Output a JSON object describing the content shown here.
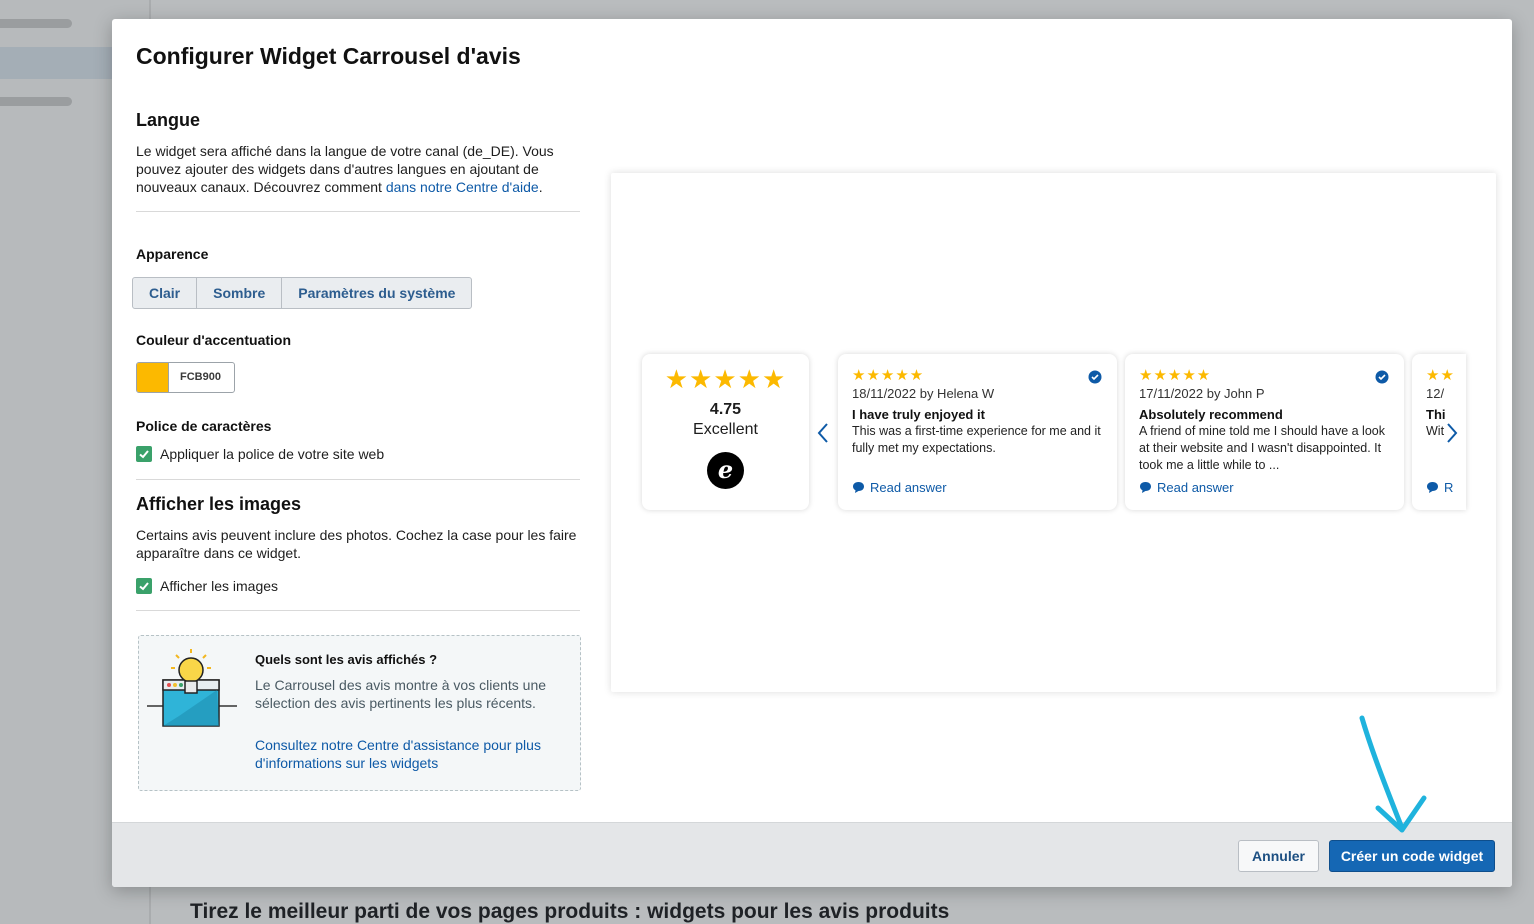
{
  "background": {
    "heading": "Tirez le meilleur parti de vos pages produits : widgets pour les avis produits"
  },
  "modal": {
    "title": "Configurer Widget Carrousel d'avis",
    "language": {
      "heading": "Langue",
      "text": "Le widget sera affiché dans la langue de votre canal (de_DE). Vous pouvez ajouter des widgets dans d'autres langues en ajoutant de nouveaux canaux. Découvrez comment",
      "link": "dans notre Centre d'aide",
      "after": "."
    },
    "appearance": {
      "label": "Apparence",
      "options": [
        "Clair",
        "Sombre",
        "Paramètres du système"
      ]
    },
    "accent": {
      "label": "Couleur d'accentuation",
      "value": "FCB900",
      "color": "#FCB900"
    },
    "font": {
      "label": "Police de caractères",
      "checkbox": "Appliquer la police de votre site web"
    },
    "images": {
      "heading": "Afficher les images",
      "text": "Certains avis peuvent inclure des photos. Cochez la case pour les faire apparaître dans ce widget.",
      "checkbox": "Afficher les images"
    },
    "info": {
      "title": "Quels sont les avis affichés ?",
      "text": "Le Carrousel des avis montre à vos clients une sélection des avis pertinents les plus récents.",
      "link": "Consultez notre Centre d'assistance pour plus d'informations sur les widgets"
    },
    "preview": {
      "summary": {
        "stars": "★★★★★",
        "rating": "4.75",
        "label": "Excellent",
        "logo": "e"
      },
      "reviews": [
        {
          "stars": "★★★★★",
          "date": "18/11/2022 by Helena W",
          "title": "I have truly enjoyed it",
          "body": "This was a first-time experience for me and it fully met my expectations.",
          "link": "Read answer"
        },
        {
          "stars": "★★★★★",
          "date": "17/11/2022 by John P",
          "title": "Absolutely recommend",
          "body": "A friend of mine told me I should have a look at their website and I wasn't disappointed. It took me a little while to ...",
          "link": "Read answer"
        },
        {
          "stars": "★★",
          "date": "12/",
          "title": "Thi",
          "body": "Wit",
          "link": "R"
        }
      ]
    },
    "footer": {
      "cancel": "Annuler",
      "create": "Créer un code widget"
    }
  }
}
